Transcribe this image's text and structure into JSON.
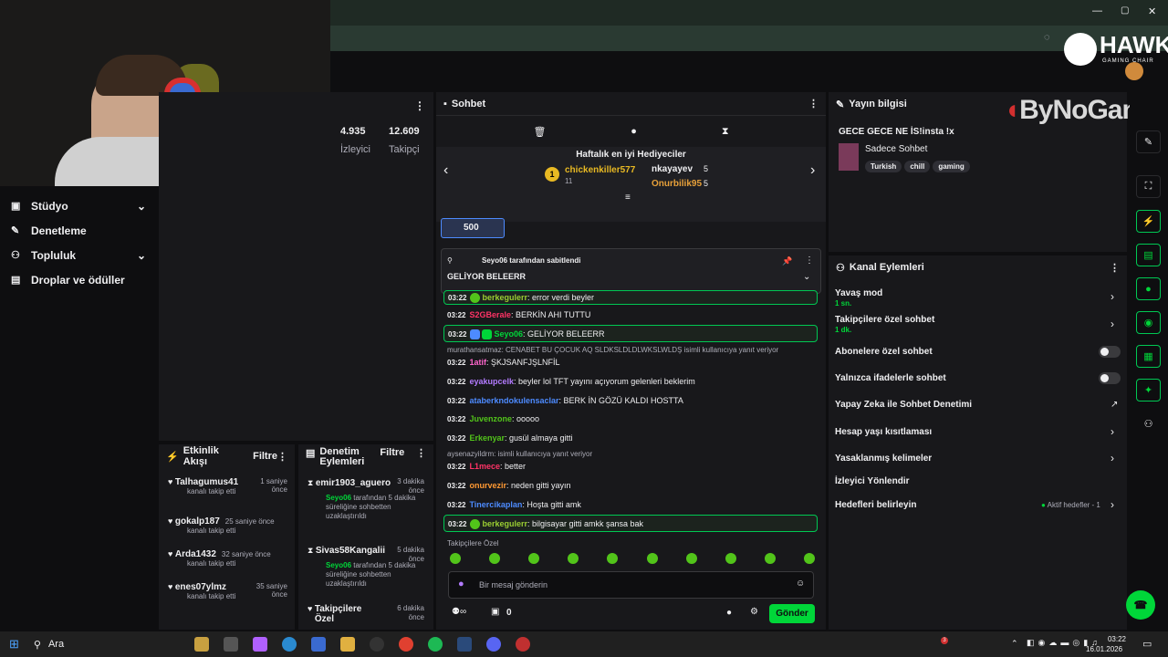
{
  "window": {
    "minimize": "—",
    "maximize": "▢",
    "close": "✕"
  },
  "brand": {
    "hawk": "HAWK",
    "hawk_sub": "GAMING CHAIR",
    "bynogame": "ByNoGame"
  },
  "sidebar": {
    "items": [
      {
        "label": "Stüdyo",
        "icon": "camera-icon",
        "chev": "⌄"
      },
      {
        "label": "Denetleme",
        "icon": "wrench-icon",
        "chev": ""
      },
      {
        "label": "Topluluk",
        "icon": "people-icon",
        "chev": "⌄"
      },
      {
        "label": "Droplar ve ödüller",
        "icon": "gift-icon",
        "chev": ""
      }
    ]
  },
  "stats": {
    "viewers": "4.935",
    "viewers_label": "İzleyici",
    "followers": "12.609",
    "followers_label": "Takipçi"
  },
  "chat": {
    "title": "Sohbet",
    "gifters_title": "Haftalık en iyi Hediyeciler",
    "gifters": [
      {
        "rank": "1",
        "name": "chickenkiller577",
        "count": "11"
      },
      {
        "name": "nkayayev",
        "count": "5"
      },
      {
        "name": "Onurbilik95",
        "count": "5"
      }
    ],
    "points": "500",
    "pinned_by": "Seyo06 tarafından sabitlendi",
    "pinned_user": "Seyo06",
    "pinned_text": "GELİYOR BELEERR",
    "messages": [
      {
        "time": "03:22",
        "user": "berkegulerr",
        "text": ": error verdi beyler",
        "color": "#9acd32"
      },
      {
        "time": "03:22",
        "user": "S2GBerale",
        "text": ": BERKİN AHI TUTTU",
        "color": "#ff3366"
      },
      {
        "time": "03:22",
        "user": "Seyo06",
        "text": ": GELİYOR BELEERR",
        "color": "#00d639"
      },
      {
        "reply": "murathansatmaz: CENABET BU ÇOCUK AQ SLDKSLDLDLWKSLWLDŞ isimli kullanıcıya yanıt veriyor"
      },
      {
        "time": "03:22",
        "user": "1atif",
        "text": ": ŞKJSANFJŞLNFİL",
        "color": "#ff66cc"
      },
      {
        "time": "03:22",
        "user": "eyakupcelk",
        "text": ": beyler lol TFT yayını açıyorum gelenleri beklerim",
        "color": "#b37bff"
      },
      {
        "time": "03:22",
        "user": "ataberkndokulensaclar",
        "text": ": BERK İN GÖZÜ KALDI HOSTTA",
        "color": "#4d8bff"
      },
      {
        "time": "03:22",
        "user": "Juvenzone",
        "text": ": ooooo",
        "color": "#52c41a"
      },
      {
        "time": "03:22",
        "user": "Erkenyar",
        "text": ": gusül almaya gitti",
        "color": "#52c41a"
      },
      {
        "reply": "aysenazyildrm: isimli kullanıcıya yanıt veriyor"
      },
      {
        "time": "03:22",
        "user": "L1mece",
        "text": ": better",
        "color": "#ff3366"
      },
      {
        "time": "03:22",
        "user": "onurvezir",
        "text": ": neden gitti yayın",
        "color": "#ff9933"
      },
      {
        "time": "03:22",
        "user": "Tinercikaplan",
        "text": ": Hoşta gitti amk",
        "color": "#4d8bff"
      },
      {
        "time": "03:22",
        "user": "berkegulerr",
        "text": ": bilgisayar gitti amkk şansa bak",
        "color": "#9acd32"
      }
    ],
    "followers_only": "Takipçilere Özel",
    "placeholder": "Bir mesaj gönderin",
    "bits": "0",
    "send": "Gönder"
  },
  "stream_info": {
    "title": "Yayın bilgisi",
    "stream_title": "GECE GECE NE İS!insta !x",
    "category": "Sadece Sohbet",
    "tags": [
      "Turkish",
      "chill",
      "gaming"
    ]
  },
  "channel_actions": {
    "title": "Kanal Eylemleri",
    "items": [
      {
        "label": "Yavaş mod",
        "sub": "1 sn."
      },
      {
        "label": "Takipçilere özel sohbet",
        "sub": "1 dk."
      },
      {
        "label": "Abonelere özel sohbet"
      },
      {
        "label": "Yalnızca ifadelerle sohbet"
      },
      {
        "label": "Yapay Zeka ile Sohbet Denetimi"
      },
      {
        "label": "Hesap yaşı kısıtlaması"
      },
      {
        "label": "Yasaklanmış kelimeler"
      },
      {
        "label": "İzleyici Yönlendir"
      },
      {
        "label": "Hedefleri belirleyin",
        "extra": "Aktif hedefler - 1"
      }
    ]
  },
  "activity": {
    "title": "Etkinlik Akışı",
    "filter": "Filtre",
    "items": [
      {
        "name": "Talhagumus41",
        "time": "1 saniye önce",
        "desc": "kanalı takip etti"
      },
      {
        "name": "gokalp187",
        "time": "25 saniye önce",
        "desc": "kanalı takip etti"
      },
      {
        "name": "Arda1432",
        "time": "32 saniye önce",
        "desc": "kanalı takip etti"
      },
      {
        "name": "enes07ylmz",
        "time": "35 saniye önce",
        "desc": "kanalı takip etti"
      }
    ]
  },
  "mod_actions": {
    "title": "Denetim Eylemleri",
    "filter": "Filtre",
    "items": [
      {
        "name": "emir1903_aguero",
        "time": "3 dakika önce",
        "by": "Seyo06",
        "desc": " tarafından 5 dakika süreliğine sohbetten uzaklaştırıldı"
      },
      {
        "name": "Sivas58Kangalii",
        "time": "5 dakika önce",
        "by": "Seyo06",
        "desc": " tarafından 5 dakika süreliğine sohbetten uzaklaştırıldı"
      },
      {
        "name": "Takipçilere Özel",
        "time": "6 dakika önce"
      }
    ]
  },
  "taskbar": {
    "search": "Ara",
    "time": "03:22",
    "date": "16.01.2026",
    "notif": "3"
  }
}
